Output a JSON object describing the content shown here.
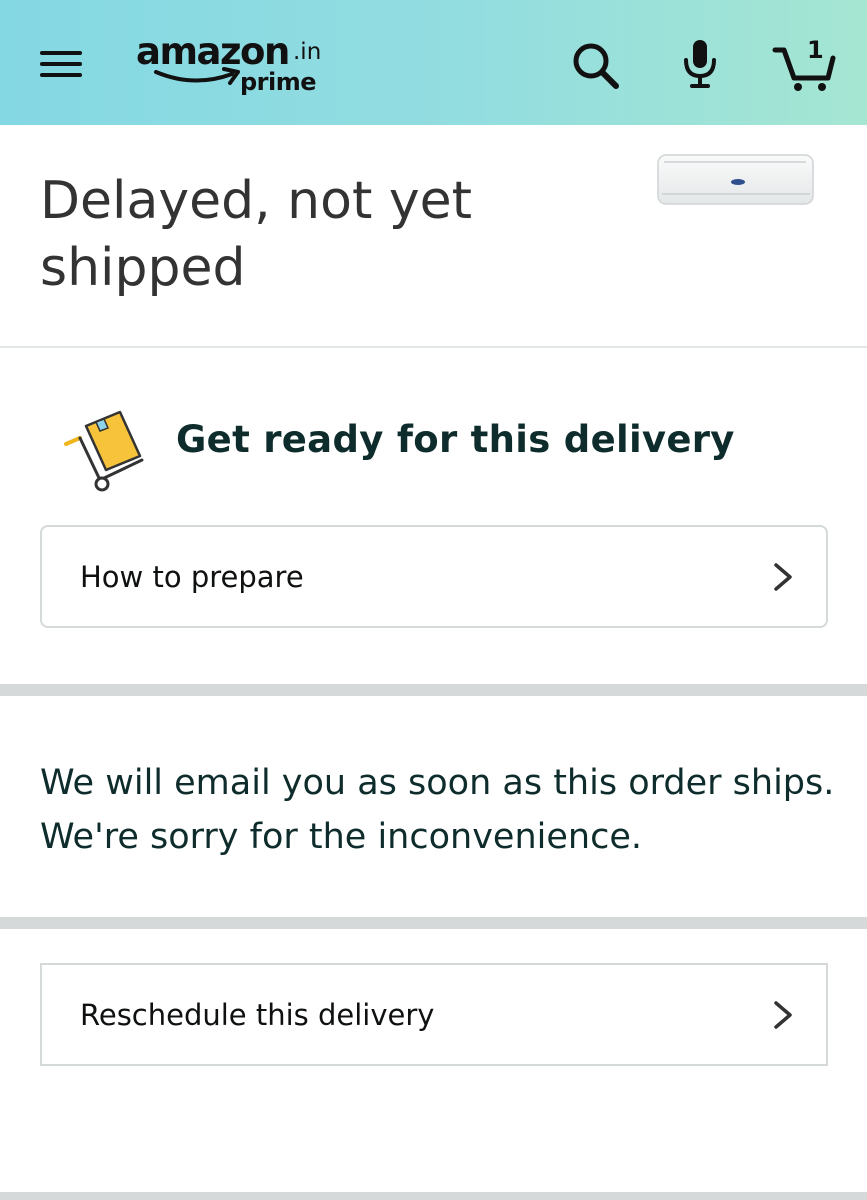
{
  "header": {
    "logo_word": "amazon",
    "logo_tld": ".in",
    "logo_prime": "prime",
    "cart_count": "1",
    "icons": [
      "menu-icon",
      "search-icon",
      "microphone-icon",
      "cart-icon"
    ],
    "gradient_colors": [
      "#84d8e3",
      "#a5e6d2"
    ]
  },
  "status": {
    "title": "Delayed, not yet shipped"
  },
  "prepare": {
    "title": "Get ready for this delivery",
    "button_label": "How to prepare"
  },
  "info": {
    "message": "We will email you as soon as this order ships. We're sorry for the inconvenience."
  },
  "reschedule": {
    "button_label": "Reschedule this delivery"
  }
}
